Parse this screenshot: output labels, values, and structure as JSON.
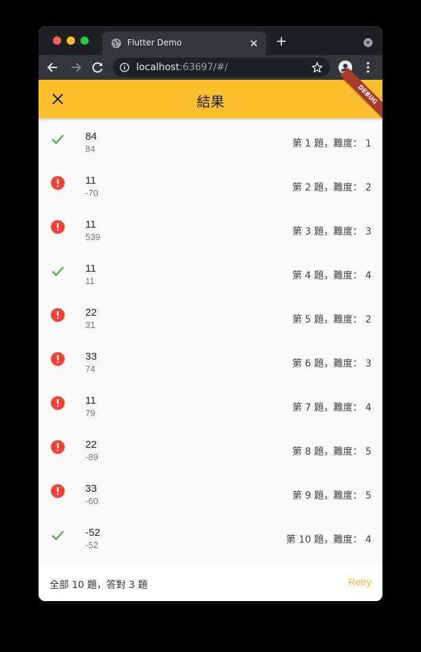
{
  "browser": {
    "tab_title": "Flutter Demo",
    "url_host": "localhost",
    "url_path": ":63697/#/"
  },
  "app": {
    "title": "結果",
    "debug_label": "DEBUG",
    "colors": {
      "appbar": "#fbbf2d",
      "correct": "#4caf50",
      "wrong": "#f44336",
      "retry": "#f5b72a"
    }
  },
  "results": [
    {
      "status": "correct",
      "answer": "84",
      "given": "84",
      "meta": "第 1 題，難度： 1"
    },
    {
      "status": "wrong",
      "answer": "11",
      "given": "-70",
      "meta": "第 2 題，難度： 2"
    },
    {
      "status": "wrong",
      "answer": "11",
      "given": "539",
      "meta": "第 3 題，難度： 3"
    },
    {
      "status": "correct",
      "answer": "11",
      "given": "11",
      "meta": "第 4 題，難度： 4"
    },
    {
      "status": "wrong",
      "answer": "22",
      "given": "31",
      "meta": "第 5 題，難度： 2"
    },
    {
      "status": "wrong",
      "answer": "33",
      "given": "74",
      "meta": "第 6 題，難度： 3"
    },
    {
      "status": "wrong",
      "answer": "11",
      "given": "79",
      "meta": "第 7 題，難度： 4"
    },
    {
      "status": "wrong",
      "answer": "22",
      "given": "-89",
      "meta": "第 8 題，難度： 5"
    },
    {
      "status": "wrong",
      "answer": "33",
      "given": "-60",
      "meta": "第 9 題，難度： 5"
    },
    {
      "status": "correct",
      "answer": "-52",
      "given": "-52",
      "meta": "第 10 題，難度： 4"
    }
  ],
  "footer": {
    "summary": "全部 10 題，答對 3 題",
    "retry_label": "Retry"
  }
}
